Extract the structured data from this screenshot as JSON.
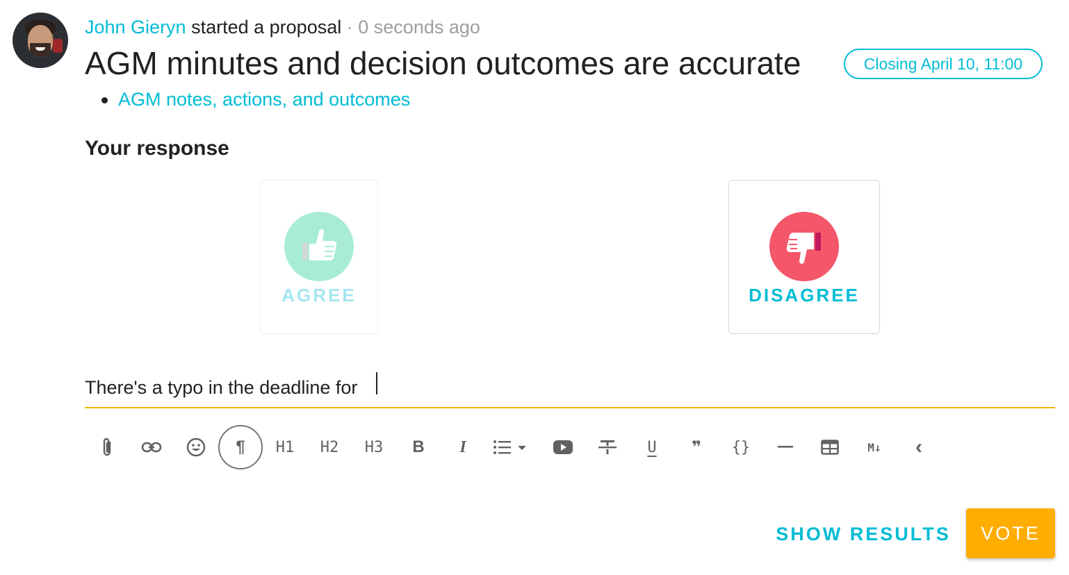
{
  "header": {
    "author": "John Gieryn",
    "action": "started a proposal",
    "separator": "·",
    "time": "0 seconds ago"
  },
  "proposal": {
    "title": "AGM minutes and decision outcomes are accurate",
    "closing": "Closing April 10, 11:00",
    "attachments": [
      {
        "label": "AGM notes, actions, and outcomes"
      }
    ]
  },
  "response": {
    "heading": "Your response",
    "options": [
      {
        "label": "AGREE",
        "icon": "thumbs-up-icon",
        "color": "#a8ecd7",
        "selected": false
      },
      {
        "label": "DISAGREE",
        "icon": "thumbs-down-icon",
        "color": "#f4566a",
        "selected": true
      }
    ]
  },
  "editor": {
    "value": "There's a typo in the deadline for",
    "accent_color": "#f4b400",
    "toolbar": [
      {
        "name": "attach-icon"
      },
      {
        "name": "link-icon"
      },
      {
        "name": "emoji-icon"
      },
      {
        "name": "paragraph-icon",
        "label": "¶",
        "active": true
      },
      {
        "name": "heading-1-button",
        "label": "H1"
      },
      {
        "name": "heading-2-button",
        "label": "H2"
      },
      {
        "name": "heading-3-button",
        "label": "H3"
      },
      {
        "name": "bold-button",
        "label": "B"
      },
      {
        "name": "italic-button",
        "label": "I"
      },
      {
        "name": "list-icon"
      },
      {
        "name": "video-icon"
      },
      {
        "name": "strikethrough-icon"
      },
      {
        "name": "underline-button",
        "label": "U"
      },
      {
        "name": "quote-icon",
        "label": "❞"
      },
      {
        "name": "code-block-button",
        "label": "{}"
      },
      {
        "name": "horizontal-rule-icon"
      },
      {
        "name": "table-icon"
      },
      {
        "name": "markdown-icon",
        "label": "M↓"
      },
      {
        "name": "collapse-icon",
        "label": "‹"
      }
    ]
  },
  "actions": {
    "show_results": "SHOW RESULTS",
    "vote": "VOTE",
    "vote_color": "#ffad00"
  }
}
